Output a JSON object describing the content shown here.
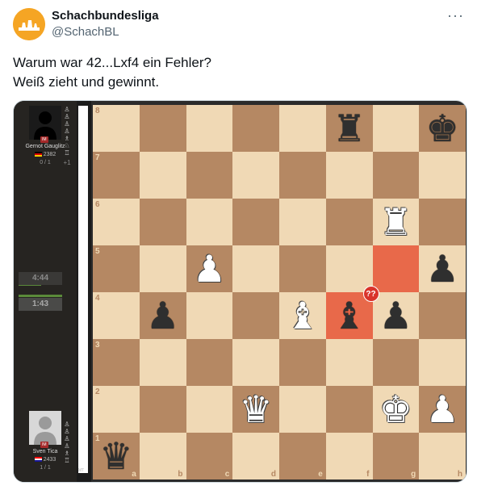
{
  "tweet": {
    "author_name": "Schachbundesliga",
    "author_handle": "@SchachBL",
    "more_icon": "···",
    "text_line1": "Warum war 42...Lxf4 ein Fehler?",
    "text_line2": "Weiß zieht und gewinnt."
  },
  "player_top": {
    "title": "IM",
    "name": "Gernot Gauglitz",
    "rating": "2382",
    "score": "0 / 1",
    "advantage": "+1",
    "captured": [
      "♙",
      "♙",
      "♙",
      "♙",
      "♗",
      "♘",
      "♖"
    ],
    "flag": "germany"
  },
  "player_bottom": {
    "title": "IM",
    "name": "Sven Tica",
    "rating": "2433",
    "score": "1 / 1",
    "captured": [
      "♙",
      "♙",
      "♙",
      "♙",
      "♗",
      "♖"
    ],
    "flag": "croatia"
  },
  "clocks": {
    "top": "4:44",
    "bottom": "1:43"
  },
  "board": {
    "ranks": [
      "8",
      "7",
      "6",
      "5",
      "4",
      "3",
      "2",
      "1"
    ],
    "files": [
      "a",
      "b",
      "c",
      "d",
      "e",
      "f",
      "g",
      "h"
    ],
    "move_mark": "??",
    "label": "MT",
    "highlights": [
      "f4",
      "g5"
    ],
    "pieces": [
      {
        "sq": "f8",
        "glyph": "♜",
        "color": "black"
      },
      {
        "sq": "h8",
        "glyph": "♚",
        "color": "black"
      },
      {
        "sq": "g6",
        "glyph": "♜",
        "color": "white"
      },
      {
        "sq": "c5",
        "glyph": "♟",
        "color": "white"
      },
      {
        "sq": "h5",
        "glyph": "♟",
        "color": "black"
      },
      {
        "sq": "b4",
        "glyph": "♟",
        "color": "black"
      },
      {
        "sq": "e4",
        "glyph": "♝",
        "color": "white"
      },
      {
        "sq": "f4",
        "glyph": "♝",
        "color": "black"
      },
      {
        "sq": "g4",
        "glyph": "♟",
        "color": "black"
      },
      {
        "sq": "d2",
        "glyph": "♛",
        "color": "white"
      },
      {
        "sq": "g2",
        "glyph": "♚",
        "color": "white"
      },
      {
        "sq": "h2",
        "glyph": "♟",
        "color": "white"
      },
      {
        "sq": "a1",
        "glyph": "♛",
        "color": "black"
      }
    ]
  },
  "colors": {
    "light_square": "#f0d9b5",
    "dark_square": "#b58863",
    "highlight": "#e8694a"
  }
}
